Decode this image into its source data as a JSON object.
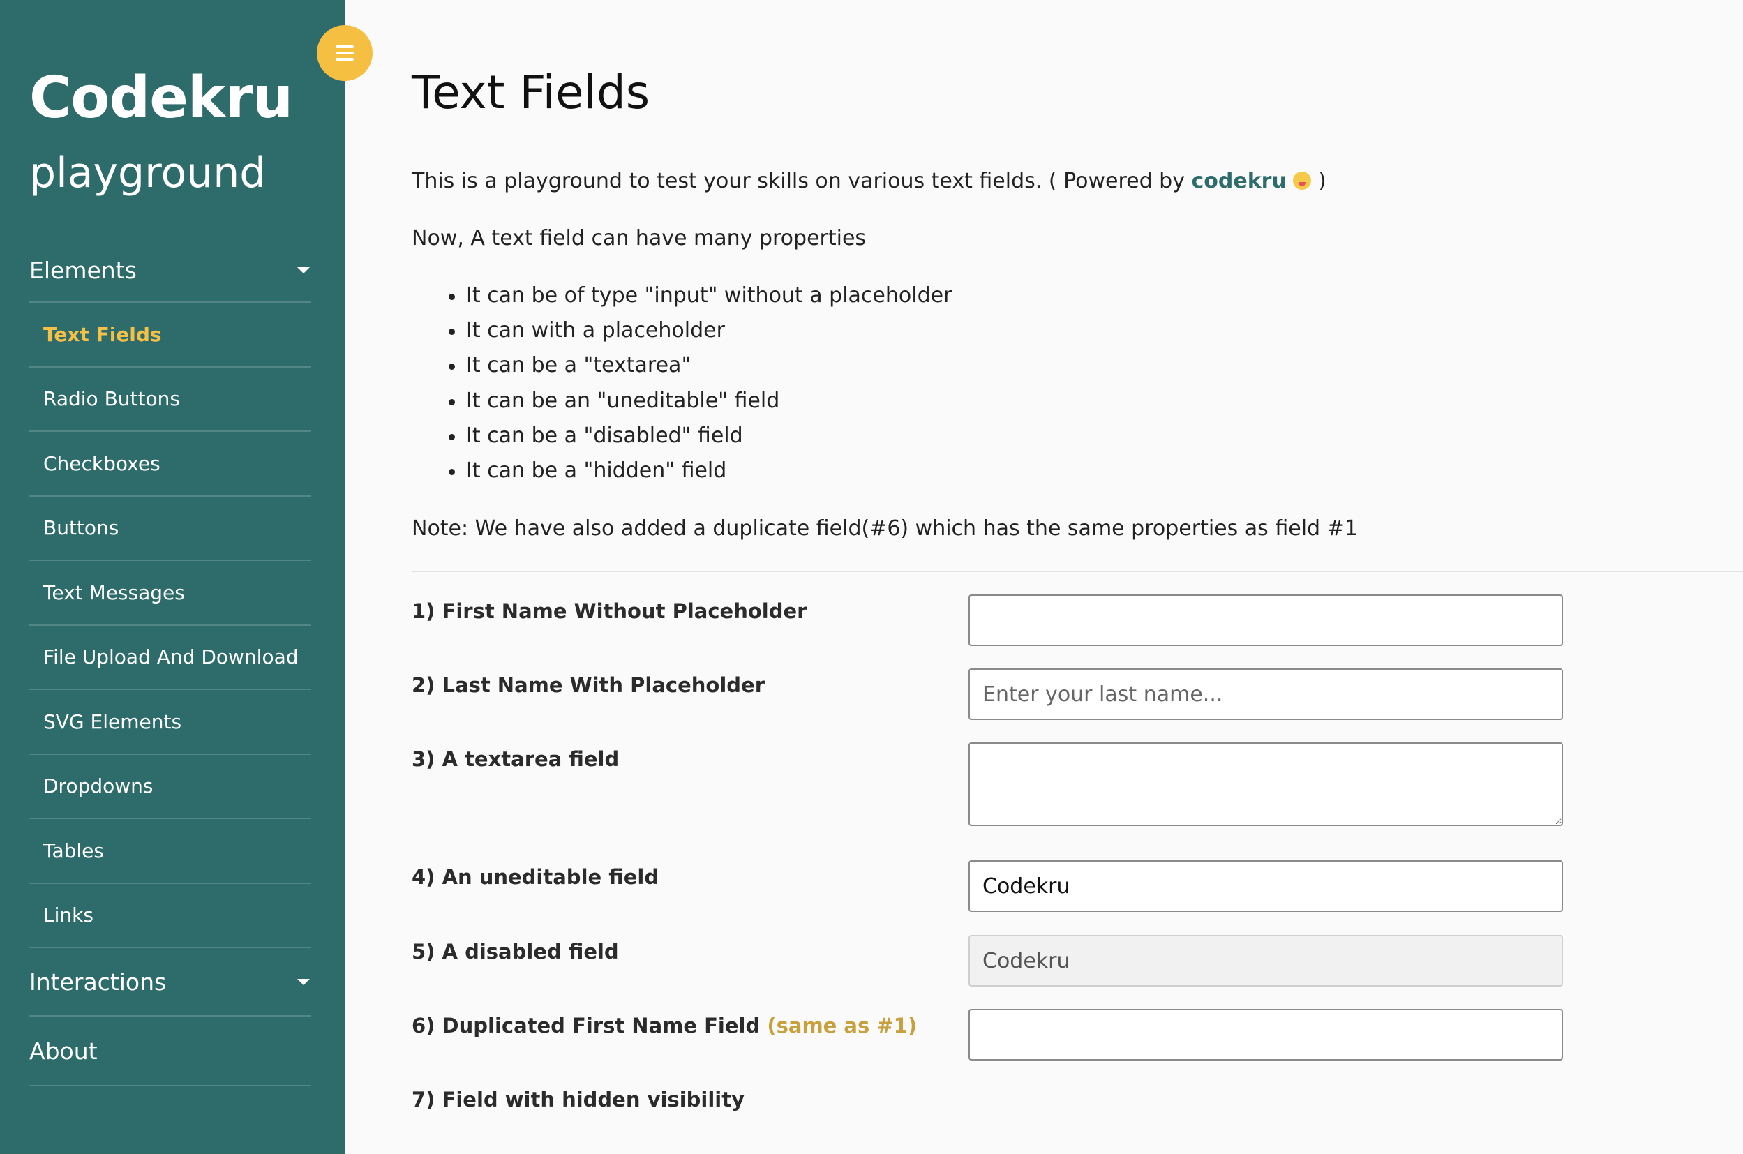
{
  "sidebar": {
    "brand": "Codekru",
    "subtitle": "playground",
    "sections": {
      "elements": "Elements",
      "interactions": "Interactions",
      "about": "About"
    },
    "items": [
      {
        "label": "Text Fields"
      },
      {
        "label": "Radio Buttons"
      },
      {
        "label": "Checkboxes"
      },
      {
        "label": "Buttons"
      },
      {
        "label": "Text Messages"
      },
      {
        "label": "File Upload And Download"
      },
      {
        "label": "SVG Elements"
      },
      {
        "label": "Dropdowns"
      },
      {
        "label": "Tables"
      },
      {
        "label": "Links"
      }
    ],
    "active_item": "Text Fields",
    "colors": {
      "background": "#2e6b6b",
      "active": "#f4c048",
      "toggle": "#f5c041"
    }
  },
  "main": {
    "title": "Text Fields",
    "intro_prefix": "This is a playground to test your skills on various text fields. ( Powered by",
    "intro_link": "codekru",
    "intro_suffix": ")",
    "properties_heading": "Now, A text field can have many properties",
    "properties": [
      "It can be of type \"input\" without a placeholder",
      "It can with a placeholder",
      "It can be a \"textarea\"",
      "It can be an \"uneditable\" field",
      "It can be a \"disabled\" field",
      "It can be a \"hidden\" field"
    ],
    "note": "Note: We have also added a duplicate field(#6) which has the same properties as field #1",
    "fields": {
      "first_name": {
        "label": "1) First Name Without Placeholder",
        "value": ""
      },
      "last_name": {
        "label": "2) Last Name With Placeholder",
        "placeholder": "Enter your last name...",
        "value": ""
      },
      "textarea": {
        "label": "3) A textarea field",
        "value": ""
      },
      "uneditable": {
        "label": "4) An uneditable field",
        "value": "Codekru"
      },
      "disabled": {
        "label": "5) A disabled field",
        "value": "Codekru"
      },
      "duplicate": {
        "label": "6) Duplicated First Name Field",
        "label_suffix": "(same as #1)",
        "value": ""
      },
      "hidden": {
        "label": "7) Field with hidden visibility"
      }
    }
  }
}
